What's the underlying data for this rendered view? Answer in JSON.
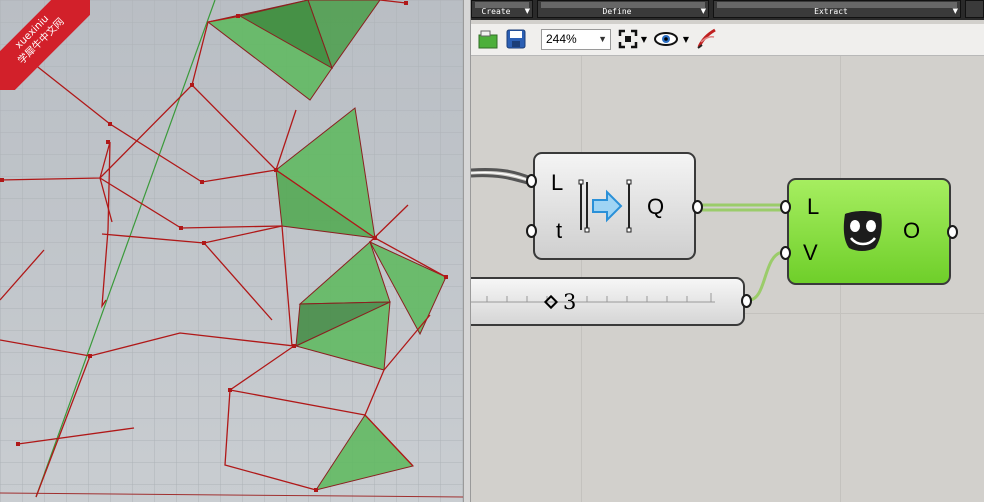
{
  "watermark": {
    "line1": "xuexiniu",
    "line2": "学犀牛中文网"
  },
  "ribbon": {
    "groups": [
      {
        "label": "Create"
      },
      {
        "label": "Define"
      },
      {
        "label": "Extract"
      }
    ]
  },
  "toolbar": {
    "zoom": "244%",
    "icons": [
      "open-file-icon",
      "save-file-icon",
      "zoom-extents-icon",
      "preview-eye-icon",
      "sketch-pen-icon"
    ]
  },
  "components": {
    "curve_component": {
      "inputs": [
        "L",
        "t"
      ],
      "outputs": [
        "Q"
      ],
      "icon": "line-extend-arrow-icon"
    },
    "output_component": {
      "inputs": [
        "L",
        "V"
      ],
      "outputs": [
        "O"
      ],
      "icon": "smiley-mask-icon"
    },
    "number_slider": {
      "value": "3"
    }
  },
  "colors": {
    "viewport_bg": "#c3c7cb",
    "curve_red": "#b01818",
    "surface_green": "#5cb85c",
    "component_green": "#7ed43a",
    "wire_green": "#9bcc6a",
    "watermark_red": "#d2202a"
  }
}
